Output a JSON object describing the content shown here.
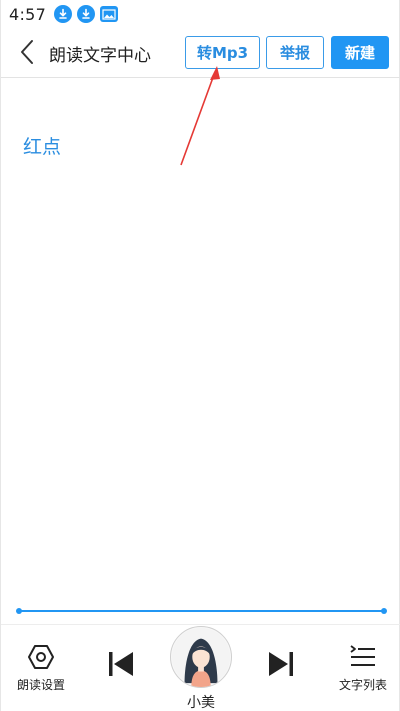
{
  "status_bar": {
    "time": "4:57",
    "icons": [
      "download-icon",
      "download-icon",
      "image-notification-icon"
    ]
  },
  "header": {
    "back_icon": "chevron-left-icon",
    "title": "朗读文字中心",
    "mp3_label": "转Mp3",
    "report_label": "举报",
    "new_label": "新建"
  },
  "content": {
    "text": "红点"
  },
  "player": {
    "settings_icon": "hexagon-settings-icon",
    "settings_label": "朗读设置",
    "prev_icon": "skip-previous-icon",
    "voice_name": "小美",
    "next_icon": "skip-next-icon",
    "list_icon": "list-icon",
    "list_label": "文字列表"
  },
  "colors": {
    "accent": "#2196f3",
    "annotation_arrow": "#e53935"
  }
}
